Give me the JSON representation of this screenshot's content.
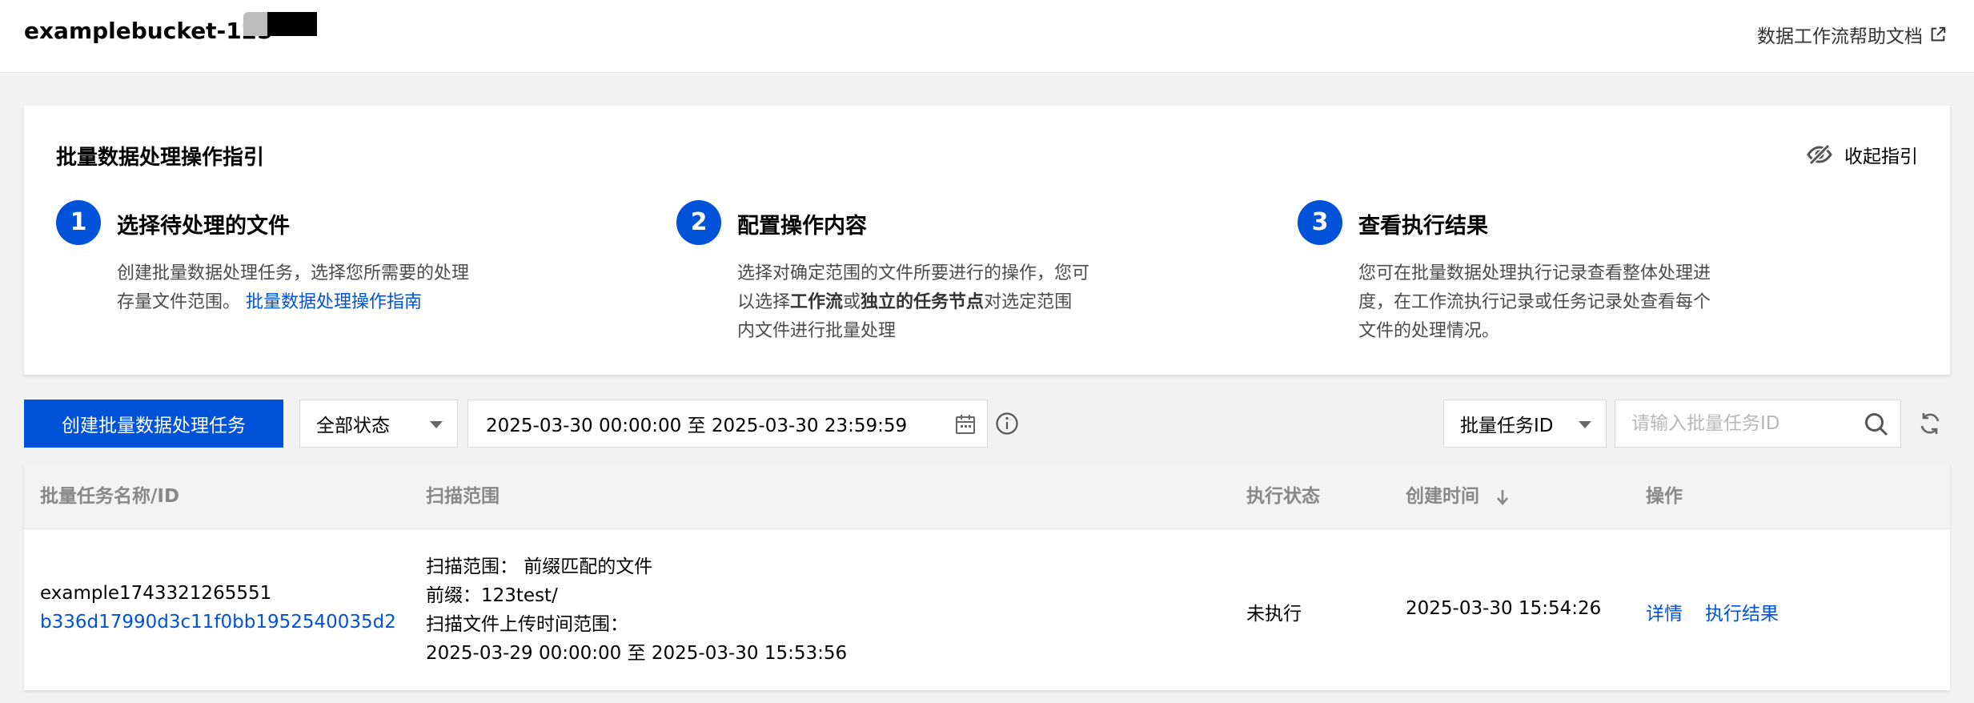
{
  "header": {
    "bucket_name": "examplebucket-125",
    "help_link": "数据工作流帮助文档",
    "help_icon": "external-link-icon"
  },
  "guide": {
    "title": "批量数据处理操作指引",
    "collapse_label": "收起指引",
    "collapse_icon": "eye-off-icon",
    "steps": [
      {
        "num": "1",
        "title": "选择待处理的文件",
        "desc": "创建批量数据处理任务，选择您所需要的处理存量文件范围。",
        "link": "批量数据处理操作指南"
      },
      {
        "num": "2",
        "title": "配置操作内容",
        "desc_a": "选择对确定范围的文件所要进行的操作，您可以选择",
        "bold_a": "工作流",
        "desc_b": "或",
        "bold_b": "独立的任务节点",
        "desc_c": "对选定范围内文件进行批量处理"
      },
      {
        "num": "3",
        "title": "查看执行结果",
        "desc": "您可在批量数据处理执行记录查看整体处理进度，在工作流执行记录或任务记录处查看每个文件的处理情况。"
      }
    ]
  },
  "toolbar": {
    "create_button": "创建批量数据处理任务",
    "status_select": "全部状态",
    "date_range": "2025-03-30 00:00:00 至 2025-03-30 23:59:59",
    "search_type": "批量任务ID",
    "search_placeholder": "请输入批量任务ID"
  },
  "table": {
    "columns": {
      "name": "批量任务名称/ID",
      "scope": "扫描范围",
      "status": "执行状态",
      "created": "创建时间",
      "actions": "操作"
    },
    "rows": [
      {
        "name": "example1743321265551",
        "id": "b336d17990d3c11f0bb1952540035d2",
        "scope_line1": "扫描范围：  前缀匹配的文件",
        "scope_line2": "前缀：123test/",
        "scope_line3": "扫描文件上传时间范围：",
        "scope_line4": "2025-03-29 00:00:00 至 2025-03-30 15:53:56",
        "status": "未执行",
        "created": "2025-03-30 15:54:26",
        "action_details": "详情",
        "action_results": "执行结果"
      }
    ]
  },
  "colors": {
    "primary": "#0052d9",
    "page_bg": "#f2f2f2",
    "header_text": "#888888"
  }
}
